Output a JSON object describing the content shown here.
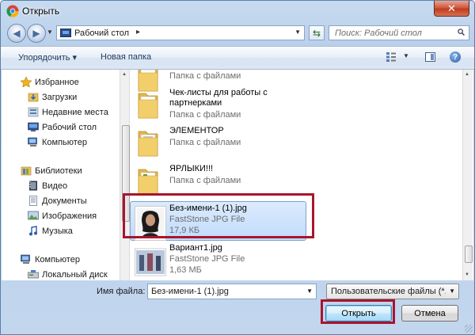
{
  "window": {
    "title": "Открыть",
    "close_label": "✕"
  },
  "address": {
    "path": "Рабочий стол",
    "separator": "▸"
  },
  "search": {
    "placeholder": "Поиск: Рабочий стол"
  },
  "toolbar": {
    "organize_label": "Упорядочить ▾",
    "new_folder_label": "Новая папка"
  },
  "nav": {
    "items": [
      {
        "label": "Избранное",
        "icon": "star-icon"
      },
      {
        "label": "Загрузки",
        "icon": "downloads-icon"
      },
      {
        "label": "Недавние места",
        "icon": "recent-places-icon"
      },
      {
        "label": "Рабочий стол",
        "icon": "desktop-icon"
      },
      {
        "label": "Компьютер",
        "icon": "computer-icon"
      },
      {
        "label": "Библиотеки",
        "icon": "libraries-icon"
      },
      {
        "label": "Видео",
        "icon": "video-icon"
      },
      {
        "label": "Документы",
        "icon": "documents-icon"
      },
      {
        "label": "Изображения",
        "icon": "images-icon"
      },
      {
        "label": "Музыка",
        "icon": "music-icon"
      },
      {
        "label": "Компьютер",
        "icon": "computer-icon"
      },
      {
        "label": "Локальный диск",
        "icon": "drive-icon"
      }
    ]
  },
  "files": [
    {
      "name": "",
      "meta1": "Папка с файлами",
      "type": "folder"
    },
    {
      "name": "Чек-листы для работы с партнерками",
      "meta1": "Папка с файлами",
      "type": "folder"
    },
    {
      "name": "ЭЛЕМЕНТОР",
      "meta1": "Папка с файлами",
      "type": "folder"
    },
    {
      "name": "ЯРЛЫКИ!!!",
      "meta1": "Папка с файлами",
      "type": "folder"
    },
    {
      "name": "Без-имени-1 (1).jpg",
      "meta1": "FastStone JPG File",
      "meta2": "17,9 КБ",
      "type": "image",
      "selected": true
    },
    {
      "name": "Вариант1.jpg",
      "meta1": "FastStone JPG File",
      "meta2": "1,63 МБ",
      "type": "image"
    }
  ],
  "bottom": {
    "filename_label": "Имя файла:",
    "filename_value": "Без-имени-1 (1).jpg",
    "filter_value": "Пользовательские файлы (*.jfi",
    "open_label": "Открыть",
    "cancel_label": "Отмена"
  },
  "colors": {
    "highlight": "#a8152d",
    "selection": "#c1dbfc",
    "window_frame": "#b9cfe9"
  }
}
